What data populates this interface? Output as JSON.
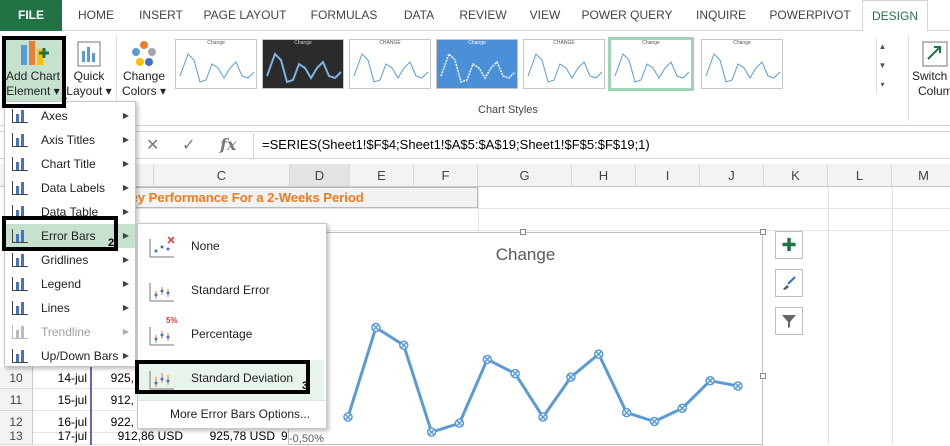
{
  "tabs": [
    "FILE",
    "HOME",
    "INSERT",
    "PAGE LAYOUT",
    "FORMULAS",
    "DATA",
    "REVIEW",
    "VIEW",
    "POWER QUERY",
    "INQUIRE",
    "POWERPIVOT",
    "DESIGN"
  ],
  "ribbon": {
    "add_chart_line1": "Add Chart",
    "add_chart_line2": "Element",
    "quick_layout_line1": "Quick",
    "quick_layout_line2": "Layout",
    "change_colors_line1": "Change",
    "change_colors_line2": "Colors",
    "chart_styles_label": "Chart Styles",
    "switch_line1": "Switch R",
    "switch_line2": "Colum",
    "thumb_titles": [
      "Change",
      "Change",
      "CHANGE",
      "Change",
      "CHANGE",
      "Change",
      "Change"
    ]
  },
  "formula_bar": {
    "fx_label": "fx",
    "formula": "=SERIES(Sheet1!$F$4;Sheet1!$A$5:$A$19;Sheet1!$F$5:$F$19;1)"
  },
  "grid": {
    "columns": [
      "C",
      "D",
      "E",
      "F",
      "G",
      "H",
      "I",
      "J",
      "K",
      "L",
      "M"
    ],
    "title_text": "ley Performance For a 2-Weeks Period",
    "rows": [
      {
        "num": "10",
        "a": "14-jul",
        "b": "925,",
        "c": "",
        "d": ""
      },
      {
        "num": "11",
        "a": "15-jul",
        "b": "912,",
        "c": "",
        "d": ""
      },
      {
        "num": "12",
        "a": "16-jul",
        "b": "922,",
        "c": "",
        "d": ""
      },
      {
        "num": "13",
        "a": "17-jul",
        "b": "912,86 USD",
        "c": "925,78 USD",
        "d": "9"
      }
    ]
  },
  "chart": {
    "axis_label": "-0,50%"
  },
  "chart_data": {
    "type": "line",
    "title": "Change",
    "x": [
      1,
      2,
      3,
      4,
      5,
      6,
      7,
      8,
      9,
      10,
      11,
      12,
      13,
      14,
      15
    ],
    "values": [
      -0.43,
      0.58,
      0.38,
      -0.6,
      -0.5,
      0.22,
      0.06,
      -0.43,
      0.02,
      0.28,
      -0.38,
      -0.48,
      -0.33,
      -0.02,
      -0.08
    ],
    "ylim": [
      -0.7,
      0.8
    ],
    "color": "#5b9bd5"
  },
  "menu": {
    "items": [
      {
        "label": "Axes",
        "arrow": true,
        "disabled": false
      },
      {
        "label": "Axis Titles",
        "arrow": true,
        "disabled": false
      },
      {
        "label": "Chart Title",
        "arrow": true,
        "disabled": false
      },
      {
        "label": "Data Labels",
        "arrow": true,
        "disabled": false
      },
      {
        "label": "Data Table",
        "arrow": true,
        "disabled": false
      },
      {
        "label": "Error Bars",
        "arrow": true,
        "disabled": false
      },
      {
        "label": "Gridlines",
        "arrow": true,
        "disabled": false
      },
      {
        "label": "Legend",
        "arrow": true,
        "disabled": false
      },
      {
        "label": "Lines",
        "arrow": true,
        "disabled": false
      },
      {
        "label": "Trendline",
        "arrow": true,
        "disabled": true
      },
      {
        "label": "Up/Down Bars",
        "arrow": true,
        "disabled": false
      }
    ]
  },
  "submenu": {
    "items": [
      "None",
      "Standard Error",
      "Percentage",
      "Standard Deviation"
    ],
    "more": "More Error Bars Options...",
    "percent_badge": "5%"
  },
  "callout_numbers": [
    "1",
    "2",
    "3"
  ],
  "colors": {
    "accent": "#217346",
    "highlight": "#c6e2cf",
    "title_orange": "#f07a1c"
  }
}
